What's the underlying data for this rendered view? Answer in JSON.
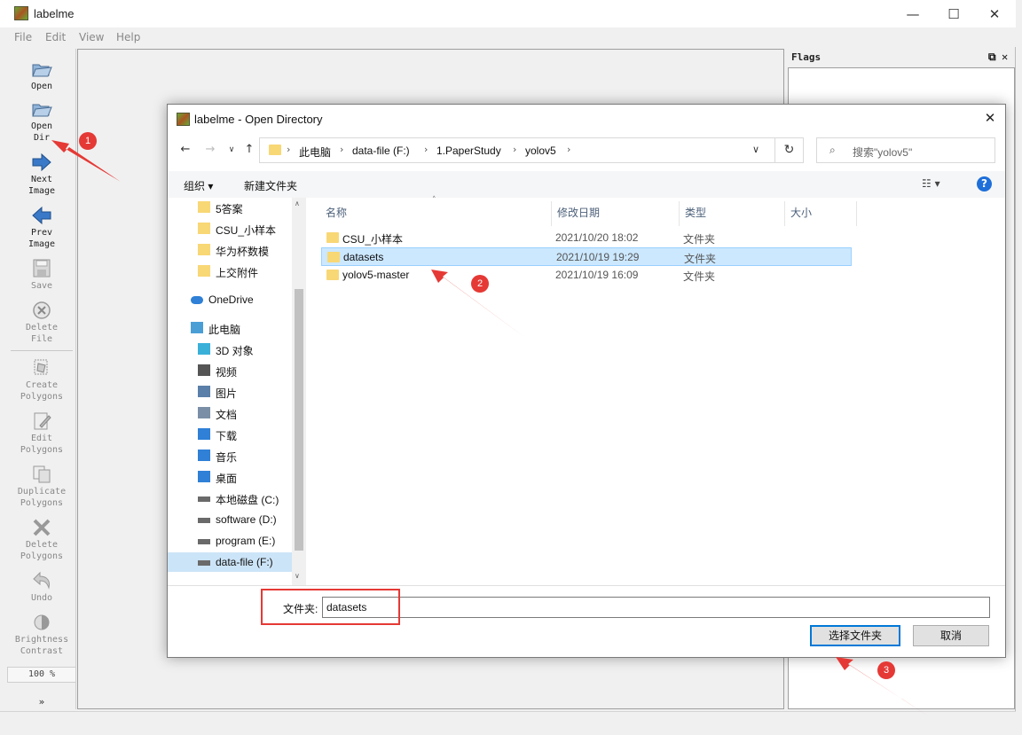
{
  "app": {
    "title": "labelme"
  },
  "window_controls": {
    "minimize": "—",
    "maximize": "☐",
    "close": "✕"
  },
  "menu": [
    "File",
    "Edit",
    "View",
    "Help"
  ],
  "toolbar": {
    "items": [
      {
        "name": "Open",
        "lines": [
          "Open"
        ],
        "icon": "folder-open-icon",
        "enabled": true
      },
      {
        "name": "Open Dir",
        "lines": [
          "Open",
          "Dir"
        ],
        "icon": "folder-open-icon",
        "enabled": true
      },
      {
        "name": "Next Image",
        "lines": [
          "Next",
          "Image"
        ],
        "icon": "arrow-right-icon",
        "enabled": true
      },
      {
        "name": "Prev Image",
        "lines": [
          "Prev",
          "Image"
        ],
        "icon": "arrow-left-icon",
        "enabled": true
      },
      {
        "name": "Save",
        "lines": [
          "Save"
        ],
        "icon": "save-icon",
        "enabled": false
      },
      {
        "name": "Delete File",
        "lines": [
          "Delete",
          "File"
        ],
        "icon": "delete-file-icon",
        "enabled": false
      },
      {
        "name": "Create Polygons",
        "lines": [
          "Create",
          "Polygons"
        ],
        "icon": "create-polygon-icon",
        "enabled": false
      },
      {
        "name": "Edit Polygons",
        "lines": [
          "Edit",
          "Polygons"
        ],
        "icon": "edit-polygon-icon",
        "enabled": false
      },
      {
        "name": "Duplicate Polygons",
        "lines": [
          "Duplicate",
          "Polygons"
        ],
        "icon": "duplicate-icon",
        "enabled": false
      },
      {
        "name": "Delete Polygons",
        "lines": [
          "Delete",
          "Polygons"
        ],
        "icon": "delete-icon",
        "enabled": false
      },
      {
        "name": "Undo",
        "lines": [
          "Undo"
        ],
        "icon": "undo-icon",
        "enabled": false
      },
      {
        "name": "Brightness Contrast",
        "lines": [
          "Brightness",
          "Contrast"
        ],
        "icon": "brightness-icon",
        "enabled": false
      }
    ],
    "zoom": "100 %",
    "more": "»"
  },
  "flags_dock": {
    "title": "Flags",
    "float_btn": "⧉",
    "close_btn": "✕"
  },
  "dialog": {
    "title": "labelme - Open Directory",
    "close": "✕",
    "breadcrumbs": [
      "此电脑",
      "data-file (F:)",
      "1.PaperStudy",
      "yolov5"
    ],
    "search_placeholder": "搜索\"yolov5\"",
    "commands": {
      "organize": "组织 ▾",
      "new_folder": "新建文件夹"
    },
    "nav_items": [
      {
        "label": "5答案",
        "icon": "folder-icon",
        "indent": 1
      },
      {
        "label": "CSU_小样本",
        "icon": "folder-icon",
        "indent": 1
      },
      {
        "label": "华为杯数模",
        "icon": "folder-icon",
        "indent": 1
      },
      {
        "label": "上交附件",
        "icon": "folder-icon",
        "indent": 1
      },
      {
        "label": "OneDrive",
        "icon": "onedrive-icon",
        "indent": 0
      },
      {
        "label": "此电脑",
        "icon": "computer-icon",
        "indent": 0
      },
      {
        "label": "3D 对象",
        "icon": "3d-objects-icon",
        "indent": 1
      },
      {
        "label": "视频",
        "icon": "video-icon",
        "indent": 1
      },
      {
        "label": "图片",
        "icon": "pictures-icon",
        "indent": 1
      },
      {
        "label": "文档",
        "icon": "documents-icon",
        "indent": 1
      },
      {
        "label": "下载",
        "icon": "download-icon",
        "indent": 1
      },
      {
        "label": "音乐",
        "icon": "music-icon",
        "indent": 1
      },
      {
        "label": "桌面",
        "icon": "desktop-icon",
        "indent": 1
      },
      {
        "label": "本地磁盘 (C:)",
        "icon": "drive-icon",
        "indent": 1
      },
      {
        "label": "software (D:)",
        "icon": "drive-icon",
        "indent": 1
      },
      {
        "label": "program (E:)",
        "icon": "drive-icon",
        "indent": 1
      },
      {
        "label": "data-file (F:)",
        "icon": "drive-icon",
        "indent": 1,
        "selected": true
      }
    ],
    "columns": [
      "名称",
      "修改日期",
      "类型",
      "大小"
    ],
    "files": [
      {
        "name": "CSU_小样本",
        "date": "2021/10/20 18:02",
        "type": "文件夹",
        "selected": false
      },
      {
        "name": "datasets",
        "date": "2021/10/19 19:29",
        "type": "文件夹",
        "selected": true
      },
      {
        "name": "yolov5-master",
        "date": "2021/10/19 16:09",
        "type": "文件夹",
        "selected": false
      }
    ],
    "folder_label": "文件夹:",
    "folder_value": "datasets",
    "select_button": "选择文件夹",
    "cancel_button": "取消"
  },
  "annotations": {
    "badge1": "1",
    "badge2": "2",
    "badge3": "3",
    "color": "#e53935"
  }
}
